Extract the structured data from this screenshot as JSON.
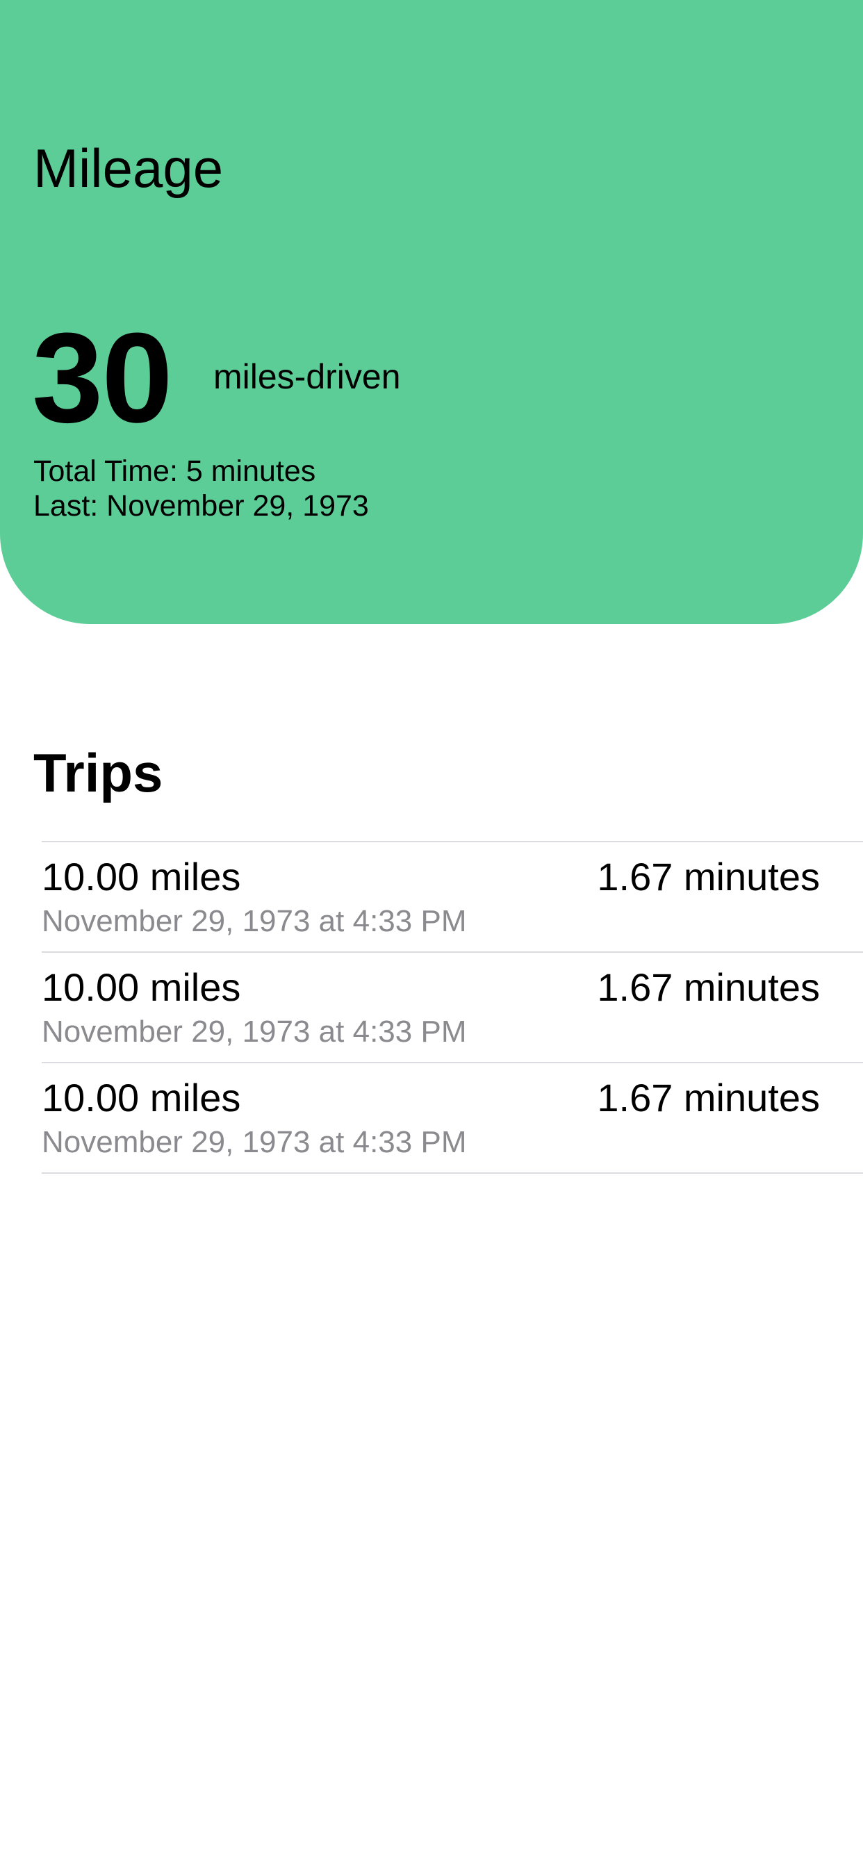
{
  "header": {
    "title": "Mileage",
    "metric_value": "30",
    "metric_unit": "miles-driven",
    "total_time": "Total Time: 5 minutes",
    "last": "Last: November 29, 1973",
    "background_color": "#5dcd98"
  },
  "trips": {
    "title": "Trips",
    "items": [
      {
        "distance": "10.00 miles",
        "duration": "1.67 minutes",
        "date": "November 29, 1973 at 4:33 PM"
      },
      {
        "distance": "10.00 miles",
        "duration": "1.67 minutes",
        "date": "November 29, 1973 at 4:33 PM"
      },
      {
        "distance": "10.00 miles",
        "duration": "1.67 minutes",
        "date": "November 29, 1973 at 4:33 PM"
      }
    ]
  }
}
